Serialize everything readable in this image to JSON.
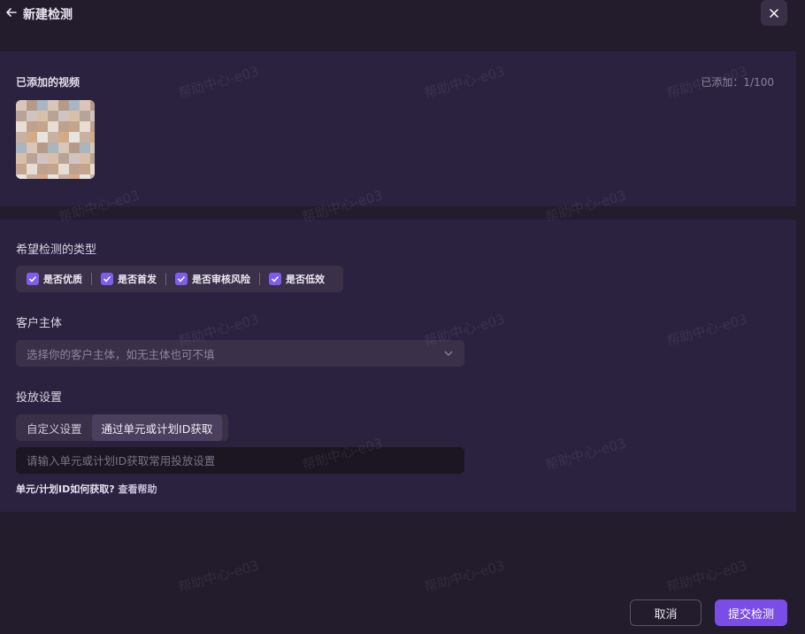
{
  "header": {
    "title": "新建检测"
  },
  "videos": {
    "title": "已添加的视频",
    "added_count": "已添加：1/100"
  },
  "detect_types": {
    "title": "希望检测的类型",
    "options": [
      {
        "label": "是否优质",
        "checked": true
      },
      {
        "label": "是否首发",
        "checked": true
      },
      {
        "label": "是否审核风险",
        "checked": true
      },
      {
        "label": "是否低效",
        "checked": true
      }
    ]
  },
  "client": {
    "title": "客户主体",
    "placeholder": "选择你的客户主体，如无主体也可不填"
  },
  "delivery": {
    "title": "投放设置",
    "tabs": [
      {
        "label": "自定义设置",
        "active": false
      },
      {
        "label": "通过单元或计划ID获取",
        "active": true
      }
    ],
    "input_placeholder": "请输入单元或计划ID获取常用投放设置",
    "help_prefix": "单元/计划ID如何获取?",
    "help_link": "查看帮助"
  },
  "footer": {
    "cancel_label": "取消",
    "submit_label": "提交检测"
  },
  "watermark_text": "帮助中心-e03",
  "colors": {
    "background": "#221c2c",
    "panel": "#2b2240",
    "accent": "#7a4de8",
    "checkbox": "#7f5cf0"
  }
}
